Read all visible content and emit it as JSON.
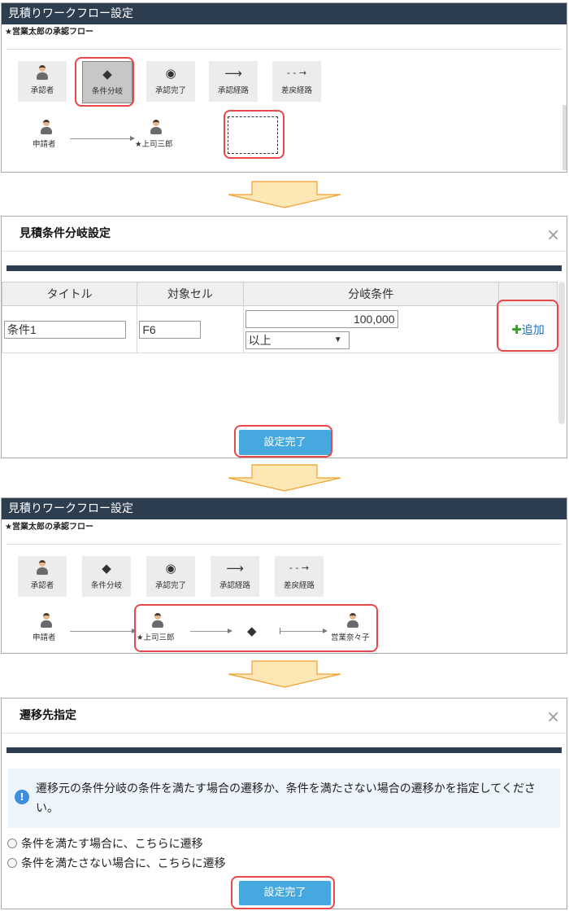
{
  "panel1": {
    "title": "見積りワークフロー設定",
    "flow_name": "★営業太郎の承認フロー",
    "tools": [
      {
        "label": "承認者",
        "icon": "person-icon"
      },
      {
        "label": "条件分岐",
        "icon": "diamond-icon",
        "glyph": "◆"
      },
      {
        "label": "承認完了",
        "icon": "target-icon",
        "glyph": "◉"
      },
      {
        "label": "承認経路",
        "icon": "arrow-right-icon",
        "glyph": "⟶"
      },
      {
        "label": "差戻経路",
        "icon": "dashed-arrow-icon",
        "glyph": "- - →"
      }
    ],
    "nodes": {
      "applicant": "申請者",
      "boss": "★上司三郎"
    }
  },
  "dialog1": {
    "title": "見積条件分岐設定",
    "close": "×",
    "columns": [
      "タイトル",
      "対象セル",
      "分岐条件"
    ],
    "row": {
      "title": "条件1",
      "cell": "F6",
      "value": "100,000",
      "operator": "以上",
      "select_caret": "▼"
    },
    "add_label": "追加",
    "add_glyph": "✚",
    "submit": "設定完了"
  },
  "panel2": {
    "title": "見積りワークフロー設定",
    "flow_name": "★営業太郎の承認フロー",
    "tools": [
      {
        "label": "承認者",
        "icon": "person-icon"
      },
      {
        "label": "条件分岐",
        "icon": "diamond-icon",
        "glyph": "◆"
      },
      {
        "label": "承認完了",
        "icon": "target-icon",
        "glyph": "◉"
      },
      {
        "label": "承認経路",
        "icon": "arrow-right-icon",
        "glyph": "⟶"
      },
      {
        "label": "差戻経路",
        "icon": "dashed-arrow-icon",
        "glyph": "- - →"
      }
    ],
    "nodes": {
      "applicant": "申請者",
      "boss": "★上司三郎",
      "sales": "営業奈々子",
      "branch_glyph": "◆"
    }
  },
  "dialog2": {
    "title": "遷移先指定",
    "close": "×",
    "info_glyph": "!",
    "message": "遷移元の条件分岐の条件を満たす場合の遷移か、条件を満たさない場合の遷移かを指定してください。",
    "options": [
      "条件を満たす場合に、こちらに遷移",
      "条件を満たさない場合に、こちらに遷移"
    ],
    "submit": "設定完了"
  },
  "colors": {
    "header": "#2c3e50",
    "accent": "#45a8df",
    "highlight": "#e8474c",
    "arrow_fill": "#fde7b4",
    "arrow_stroke": "#f0a030"
  }
}
